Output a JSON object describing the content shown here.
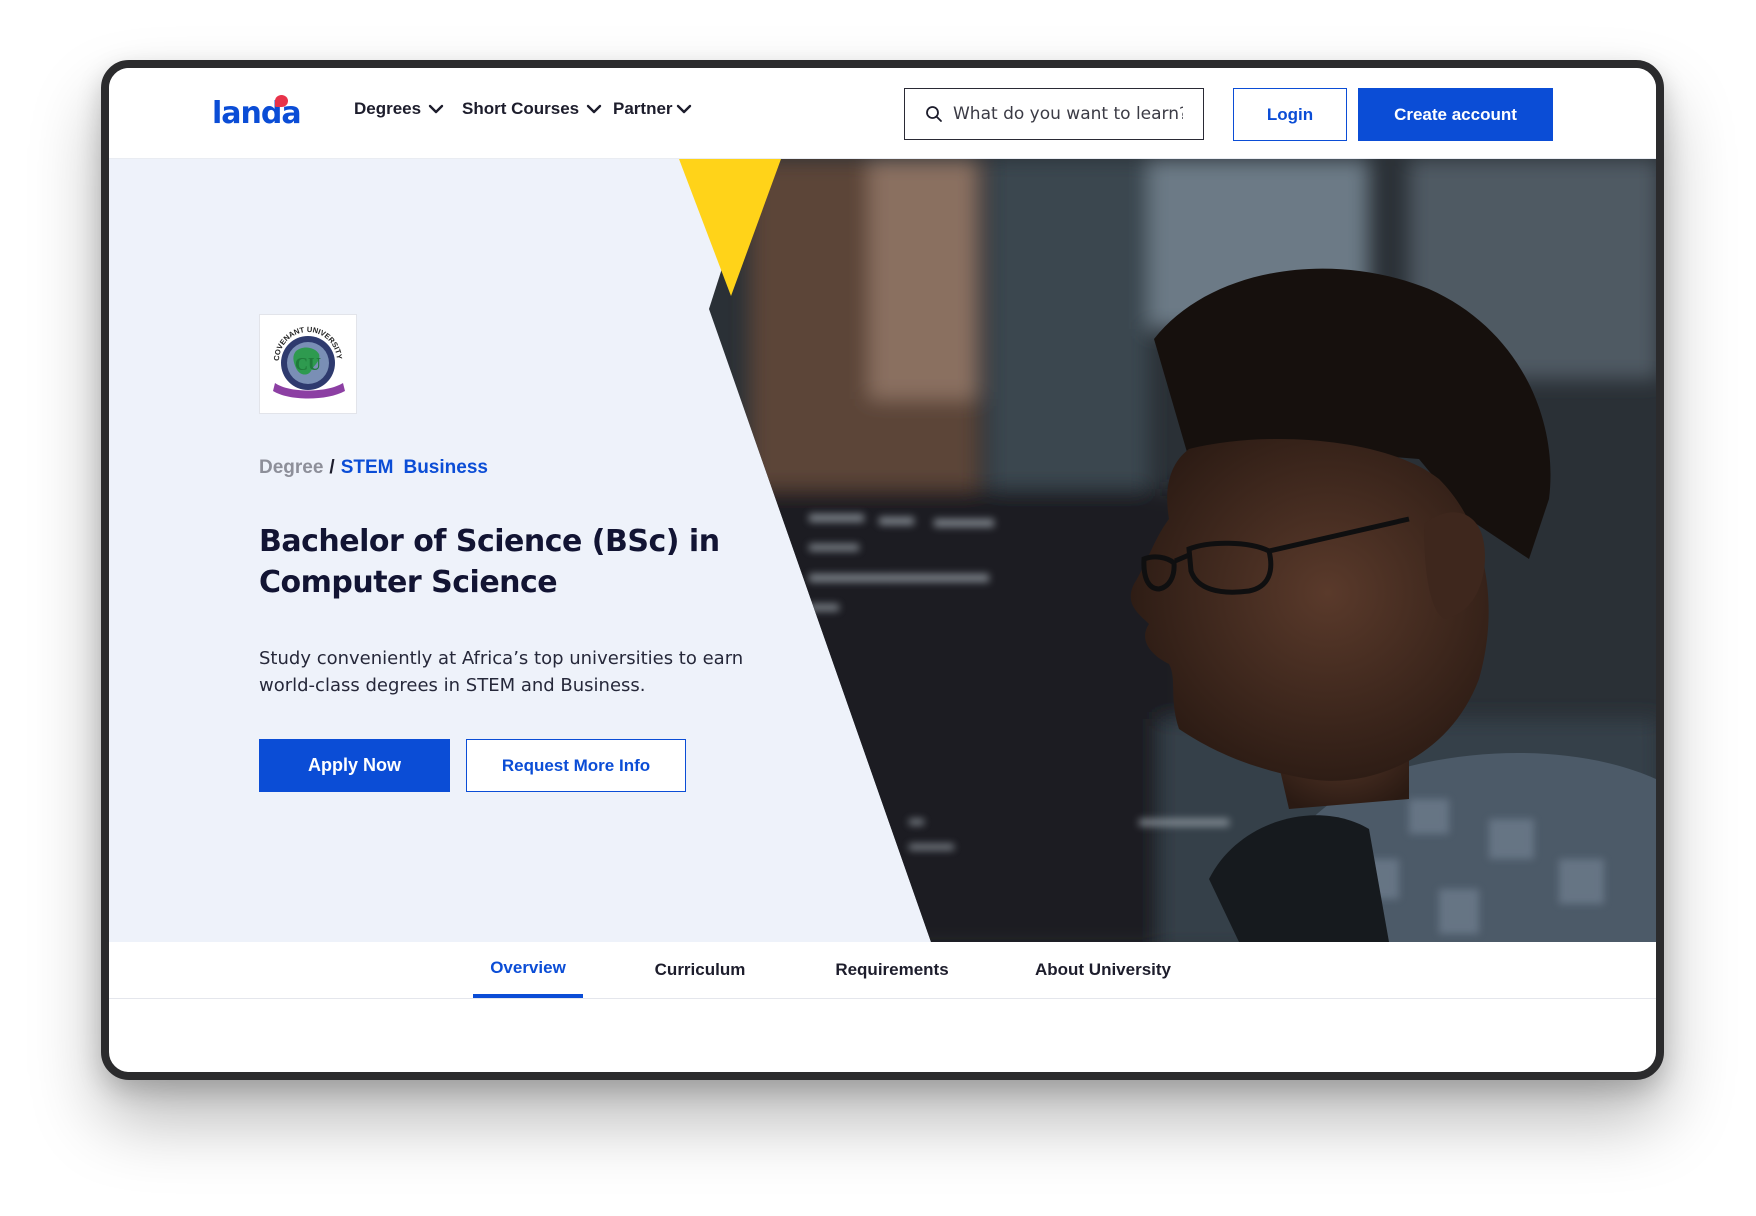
{
  "header": {
    "logo_text": "landa",
    "nav": [
      {
        "label": "Degrees"
      },
      {
        "label": "Short Courses"
      },
      {
        "label": "Partner"
      }
    ],
    "search_placeholder": "What do you want to learn?",
    "login_label": "Login",
    "create_account_label": "Create account"
  },
  "hero": {
    "breadcrumb": {
      "root": "Degree",
      "separator": "/",
      "links": [
        "STEM",
        "Business"
      ]
    },
    "title": "Bachelor of Science (BSc) in Computer Science",
    "description": "Study conveniently at Africa’s top universities to earn world-class degrees in STEM and Business.",
    "apply_label": "Apply Now",
    "info_label": "Request More Info",
    "university_logo_text": "COVENANT UNIVERSITY"
  },
  "tabs": [
    {
      "label": "Overview",
      "active": true
    },
    {
      "label": "Curriculum",
      "active": false
    },
    {
      "label": "Requirements",
      "active": false
    },
    {
      "label": "About University",
      "active": false
    }
  ],
  "colors": {
    "brand_blue": "#0b4dd6",
    "accent_yellow": "#ffd319",
    "hero_bg": "#eef2fa",
    "logo_dot": "#e8334a"
  }
}
